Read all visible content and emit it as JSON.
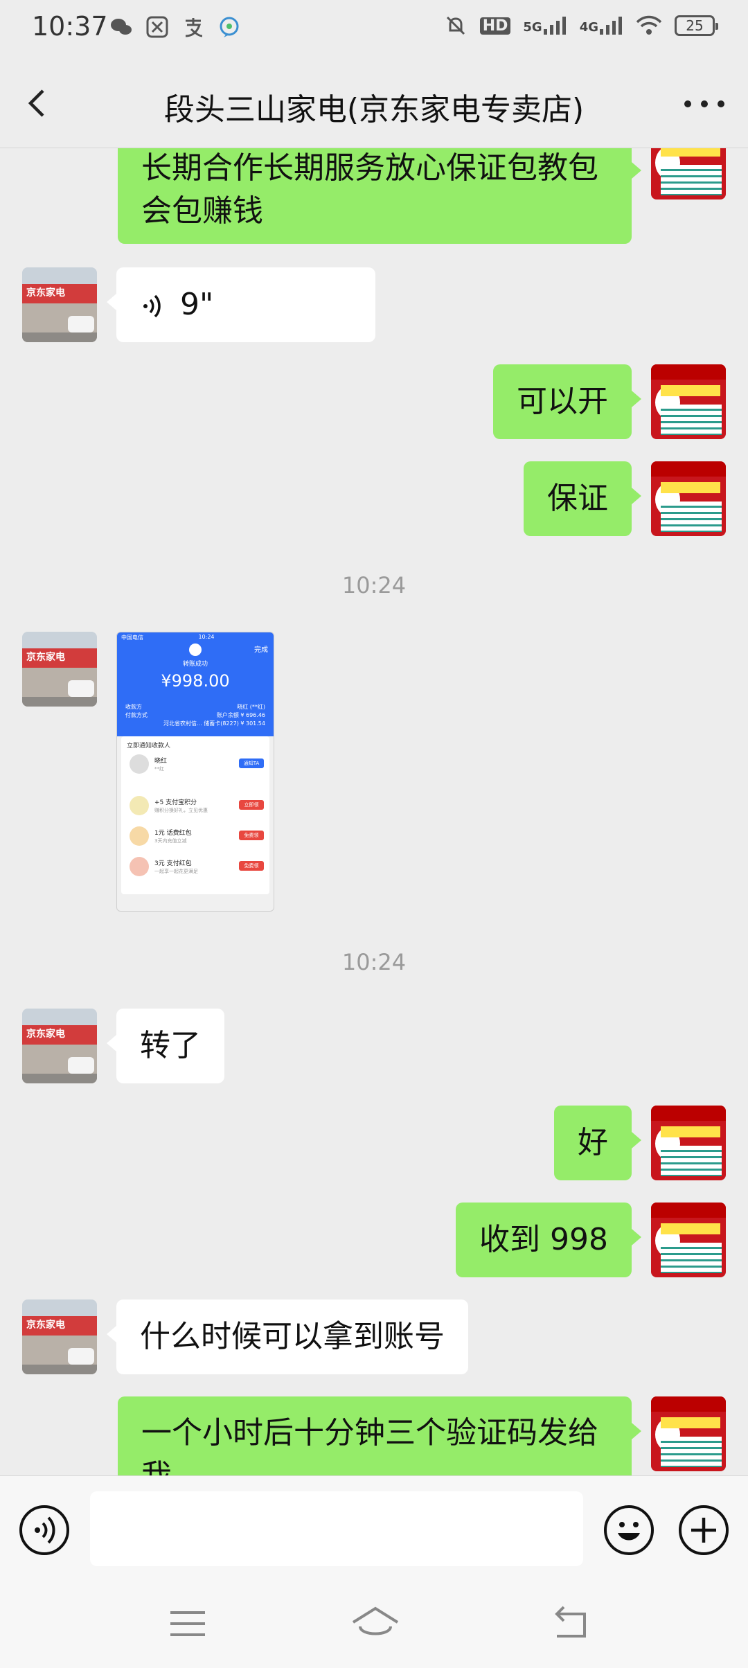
{
  "status_bar": {
    "time": "10:37",
    "network_hd": "HD",
    "network_5g": "5G",
    "network_4g": "4G",
    "battery": "25"
  },
  "header": {
    "title": "段头三山家电(京东家电专卖店)"
  },
  "store_avatar_sign": "京东家电",
  "messages": {
    "m1": "长期合作长期服务放心保证包教包会包赚钱",
    "m2_voice_duration": "9\"",
    "m3": "可以开",
    "m4": "保证",
    "time1": "10:24",
    "time2": "10:24",
    "m6": "转了",
    "m7": "好",
    "m8": "收到 998",
    "m9": "什么时候可以拿到账号",
    "m10": "一个小时后十分钟三个验证码发给我"
  },
  "transfer_screenshot": {
    "carrier": "中国电信",
    "time": "10:24",
    "done": "完成",
    "status": "转账成功",
    "amount": "¥998.00",
    "payee_label": "收款方",
    "payee_value": "晓红 (**红)",
    "method_label": "付款方式",
    "balance": "账户余额 ¥ 696.46",
    "detail": "河北省农村信... 储蓄卡(8227) ¥ 301.54",
    "notify_title": "立即通知收款人",
    "contact_name": "晓红",
    "contact_sub": "**红",
    "notify_btn": "通知TA",
    "items": [
      {
        "title": "+5 支付宝积分",
        "sub": "赚积分换好礼，立见优惠",
        "btn": "立即领"
      },
      {
        "title": "1元 话费红包",
        "sub": "3天内充值立减",
        "btn": "免费领"
      },
      {
        "title": "3元 支付红包",
        "sub": "一起享一起花更满足",
        "btn": "免费领"
      }
    ]
  },
  "colors": {
    "bubble_green": "#95ec69",
    "bubble_white": "#ffffff",
    "background": "#ededed",
    "alipay_blue": "#2f6df6"
  }
}
